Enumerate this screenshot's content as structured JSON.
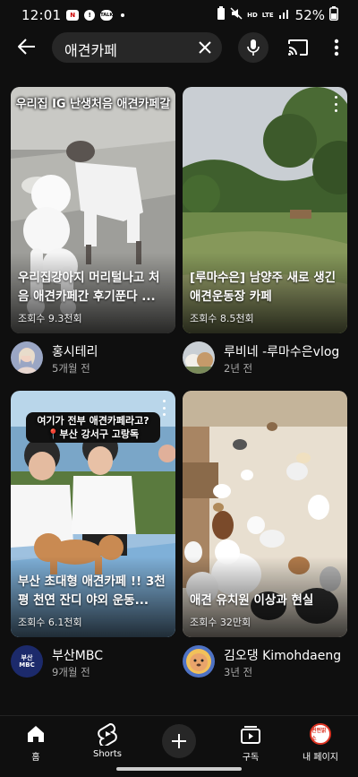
{
  "status_bar": {
    "time": "12:01",
    "notif_icons": [
      "N",
      "!",
      "TALK"
    ],
    "network_labels": [
      "HD",
      "LTE"
    ],
    "battery_percent": "52%"
  },
  "search": {
    "query": "애견카페"
  },
  "videos": [
    {
      "thumb_caption": "우리집 IG 난생처음 애견카페갈",
      "title": "우리집강아지 머리털나고 처음 애견카페간 후기푼다 ...",
      "views": "조회수 9.3천회",
      "channel": "홍시테리",
      "age": "5개월 전"
    },
    {
      "thumb_caption": "",
      "title": "[루마수은] 남양주 새로 생긴 애견운동장 카페",
      "views": "조회수 8.5천회",
      "channel": "루비네 -루마수은vlog",
      "age": "2년 전"
    },
    {
      "thumb_caption": "여기가 전부 애견카페라고? 📍부산 강서구 고랑독",
      "title": "부산 초대형 애견카페 !! 3천평 천연 잔디 야외 운동...",
      "views": "조회수 6.1천회",
      "channel": "부산MBC",
      "age": "9개월 전",
      "avatar_text": "부산 MBC"
    },
    {
      "thumb_caption": "",
      "title": "애견 유치원 이상과 현실",
      "views": "조회수 32만회",
      "channel": "김오댕  Kimohdaeng",
      "age": "3년 전"
    }
  ],
  "bottom_nav": {
    "home": "홈",
    "shorts": "Shorts",
    "subscriptions": "구독",
    "you": "내 페이지",
    "profile_badge": "펀펀밝소"
  },
  "colors": {
    "background": "#0f0f0f",
    "surface": "#272727",
    "secondary_text": "#aaaaaa"
  }
}
